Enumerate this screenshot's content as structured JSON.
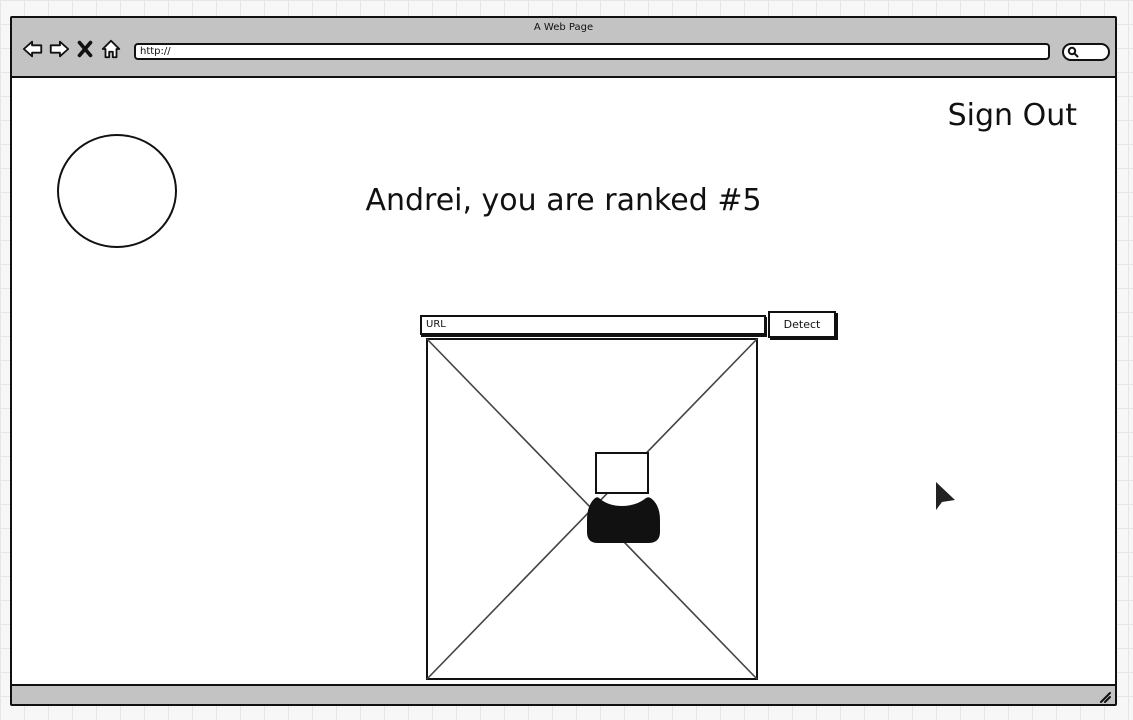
{
  "browser": {
    "title": "A Web Page",
    "url": "http://",
    "nav_icons": [
      "back-arrow-icon",
      "forward-arrow-icon",
      "close-icon",
      "home-icon"
    ],
    "search_icon": "search-icon"
  },
  "page": {
    "sign_out_label": "Sign Out",
    "rank_text": "Andrei, you are ranked #5",
    "url_input_placeholder": "URL",
    "detect_label": "Detect",
    "image_icon": "image-placeholder",
    "face_icon": "person-icon"
  },
  "colors": {
    "chrome": "#c3c3c3",
    "ink": "#111111",
    "canvas": "#ffffff"
  }
}
